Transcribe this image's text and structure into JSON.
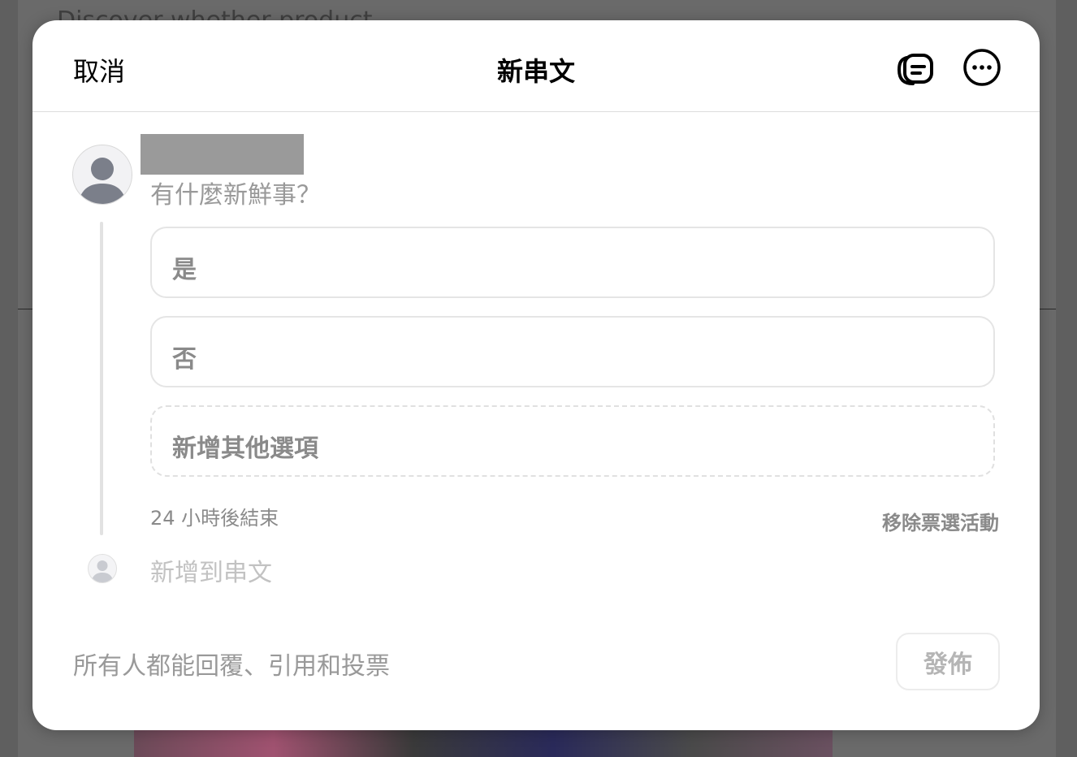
{
  "background": {
    "partial_text": "Discover whether product"
  },
  "header": {
    "cancel_label": "取消",
    "title": "新串文"
  },
  "composer": {
    "placeholder": "有什麼新鮮事？"
  },
  "poll": {
    "options": [
      "是",
      "否"
    ],
    "add_option_label": "新增其他選項",
    "duration_label": "24 小時後結束",
    "remove_label": "移除票選活動"
  },
  "thread": {
    "add_label": "新增到串文"
  },
  "footer": {
    "reply_setting": "所有人都能回覆、引用和投票",
    "post_label": "發佈"
  },
  "icons": {
    "drafts": "drafts-icon",
    "more": "more-options-icon",
    "avatar": "avatar-placeholder-icon"
  },
  "colors": {
    "overlay": "#5f5f5f",
    "modal_bg": "#ffffff",
    "muted_text": "#999999",
    "border": "#e5e5e5"
  }
}
